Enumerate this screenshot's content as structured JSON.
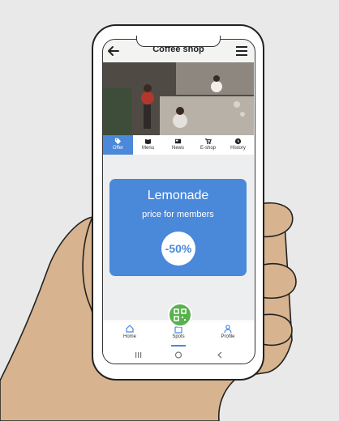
{
  "app": {
    "title": "Coffee shop"
  },
  "tabs": [
    {
      "label": "Offer",
      "icon": "tag-icon",
      "active": true
    },
    {
      "label": "Menu",
      "icon": "book-icon",
      "active": false
    },
    {
      "label": "News",
      "icon": "newspaper-icon",
      "active": false
    },
    {
      "label": "E-shop",
      "icon": "cart-icon",
      "active": false
    },
    {
      "label": "History",
      "icon": "clock-icon",
      "active": false
    }
  ],
  "offer": {
    "title": "Lemonade",
    "subtitle": "price for members",
    "discount": "-50%"
  },
  "bottom_nav": [
    {
      "label": "Home",
      "icon": "home-icon"
    },
    {
      "label": "Spots",
      "icon": "bag-icon",
      "active": true
    },
    {
      "label": "Profile",
      "icon": "person-icon"
    }
  ],
  "colors": {
    "accent": "#4a88da",
    "qr_button": "#5ab04e",
    "hand": "#d7b48f"
  }
}
